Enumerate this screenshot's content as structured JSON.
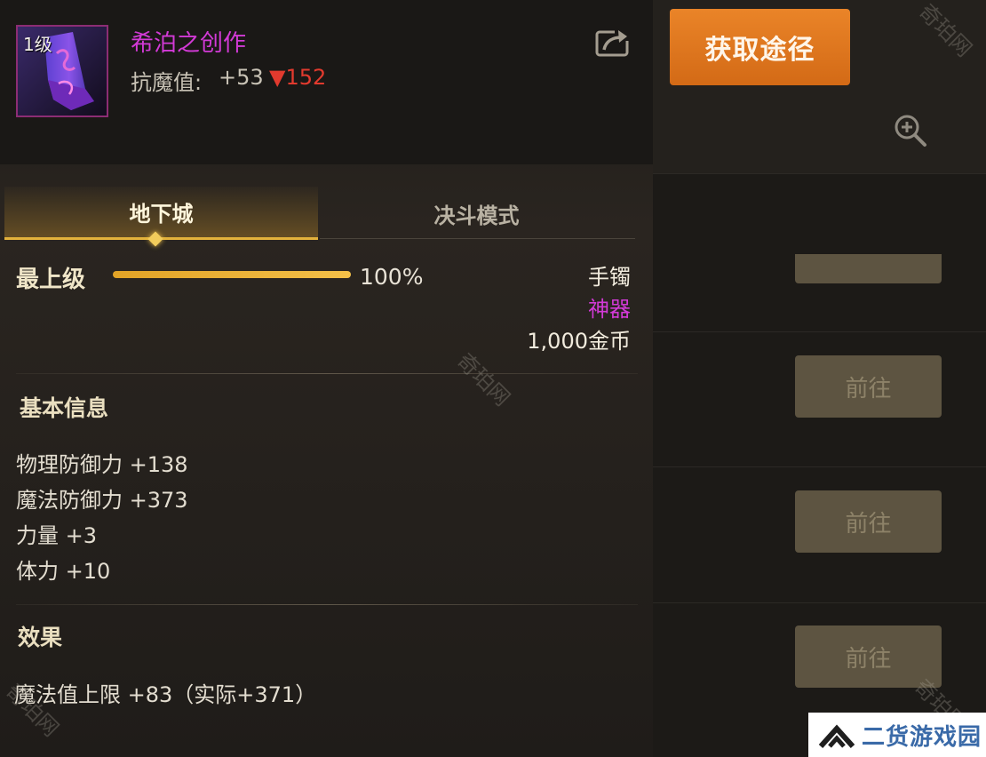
{
  "item": {
    "level": "1级",
    "name": "希泊之创作",
    "resist_label": "抗魔值:",
    "resist_value": "+53",
    "resist_delta": "▼152"
  },
  "tabs": [
    {
      "label": "地下城",
      "active": true
    },
    {
      "label": "决斗模式",
      "active": false
    }
  ],
  "grade": {
    "label": "最上级",
    "percent_text": "100%",
    "percent": 100
  },
  "meta": {
    "slot": "手镯",
    "rarity": "神器",
    "price": "1,000金币"
  },
  "basic_info": {
    "title": "基本信息",
    "stats": [
      "物理防御力 +138",
      "魔法防御力 +373",
      "力量 +3",
      "体力 +10"
    ]
  },
  "effects": {
    "title": "效果",
    "lines": [
      "魔法值上限 +83（实际+371）"
    ]
  },
  "right_panel": {
    "acquire_label": "获取途径",
    "goto_labels": [
      "前往",
      "前往",
      "前往"
    ]
  },
  "watermark_text": "奇珀网",
  "logo_text": "二货游戏园",
  "colors": {
    "rarity": "#d23ad6",
    "accent": "#e3b23c",
    "acquire": "#e07a20",
    "delta": "#e23a2e"
  },
  "icons": [
    "share-icon",
    "zoom-in-icon",
    "bracelet-item-icon"
  ]
}
